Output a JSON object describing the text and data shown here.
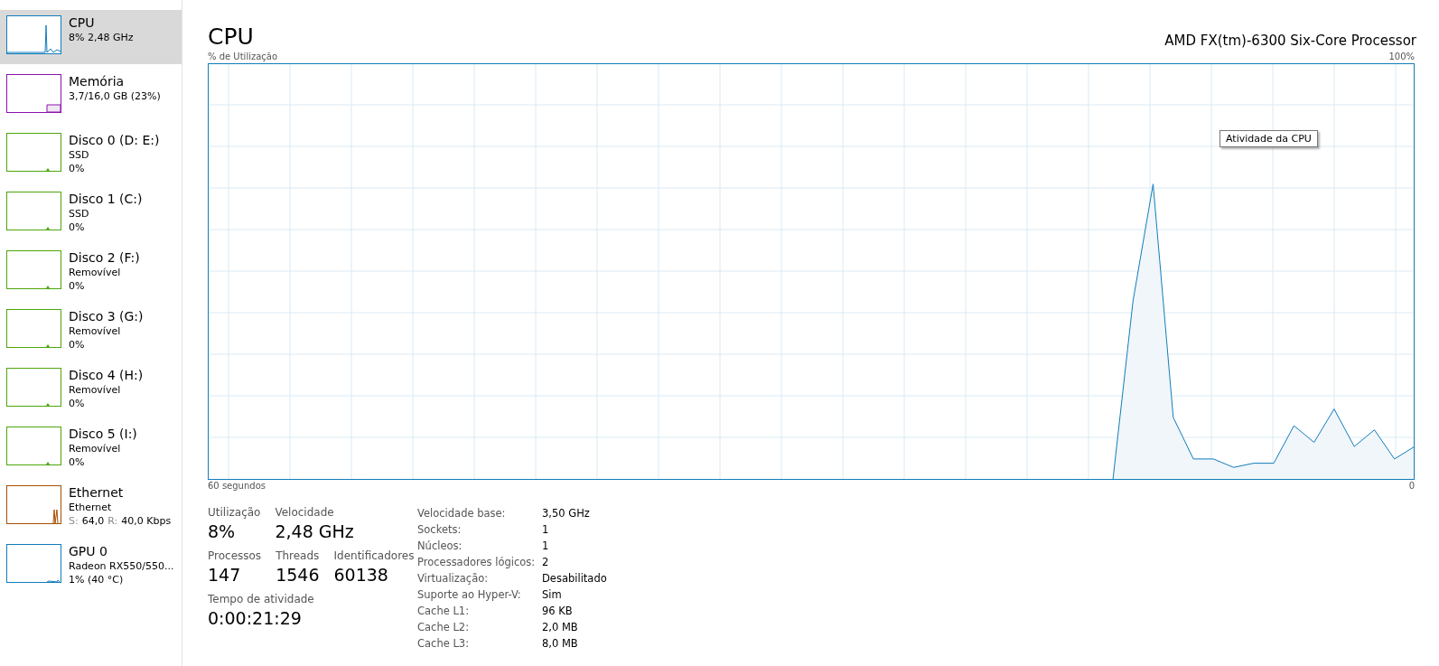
{
  "sidebar": {
    "items": [
      {
        "kind": "cpu",
        "title": "CPU",
        "lines": [
          "8% 2,48 GHz"
        ],
        "color": "#117dbb",
        "selected": true
      },
      {
        "kind": "memory",
        "title": "Memória",
        "lines": [
          "3,7/16,0 GB (23%)"
        ],
        "color": "#8b12ae",
        "selected": false
      },
      {
        "kind": "disk",
        "title": "Disco 0 (D: E:)",
        "lines": [
          "SSD",
          "0%"
        ],
        "color": "#4da60c",
        "selected": false
      },
      {
        "kind": "disk",
        "title": "Disco 1 (C:)",
        "lines": [
          "SSD",
          "0%"
        ],
        "color": "#4da60c",
        "selected": false
      },
      {
        "kind": "disk",
        "title": "Disco 2 (F:)",
        "lines": [
          "Removível",
          "0%"
        ],
        "color": "#4da60c",
        "selected": false
      },
      {
        "kind": "disk",
        "title": "Disco 3 (G:)",
        "lines": [
          "Removível",
          "0%"
        ],
        "color": "#4da60c",
        "selected": false
      },
      {
        "kind": "disk",
        "title": "Disco 4 (H:)",
        "lines": [
          "Removível",
          "0%"
        ],
        "color": "#4da60c",
        "selected": false
      },
      {
        "kind": "disk",
        "title": "Disco 5 (I:)",
        "lines": [
          "Removível",
          "0%"
        ],
        "color": "#4da60c",
        "selected": false
      },
      {
        "kind": "network",
        "title": "Ethernet",
        "lines": [
          "Ethernet"
        ],
        "throughput": [
          {
            "label": "S:",
            "value": "64,0"
          },
          {
            "label": "R:",
            "value": "40,0 Kbps"
          }
        ],
        "color": "#a74f01",
        "selected": false
      },
      {
        "kind": "gpu",
        "title": "GPU 0",
        "lines": [
          "Radeon RX550/550...",
          "1% (40 °C)"
        ],
        "color": "#117dbb",
        "selected": false
      }
    ]
  },
  "header": {
    "title": "CPU",
    "processor": "AMD FX(tm)-6300 Six-Core Processor"
  },
  "chart": {
    "axis_title": "% de Utilização",
    "scale_max_label": "100%",
    "tooltip": "Atividade da CPU",
    "time_span_label": "60 segundos",
    "scale_min_label": "0"
  },
  "stats": {
    "rows": [
      [
        {
          "label": "Utilização",
          "value": "8%"
        },
        {
          "label": "Velocidade",
          "value": "2,48 GHz"
        }
      ],
      [
        {
          "label": "Processos",
          "value": "147"
        },
        {
          "label": "Threads",
          "value": "1546"
        },
        {
          "label": "Identificadores",
          "value": "60138"
        }
      ],
      [
        {
          "label": "Tempo de atividade",
          "value": "0:00:21:29"
        }
      ]
    ],
    "details": [
      {
        "label": "Velocidade base:",
        "value": "3,50 GHz"
      },
      {
        "label": "Sockets:",
        "value": "1"
      },
      {
        "label": "Núcleos:",
        "value": "1"
      },
      {
        "label": "Processadores lógicos:",
        "value": "2"
      },
      {
        "label": "Virtualização:",
        "value": "Desabilitado"
      },
      {
        "label": "Suporte ao Hyper-V:",
        "value": "Sim"
      },
      {
        "label": "Cache L1:",
        "value": "96 KB"
      },
      {
        "label": "Cache L2:",
        "value": "2,0 MB"
      },
      {
        "label": "Cache L3:",
        "value": "8,0 MB"
      }
    ]
  }
}
